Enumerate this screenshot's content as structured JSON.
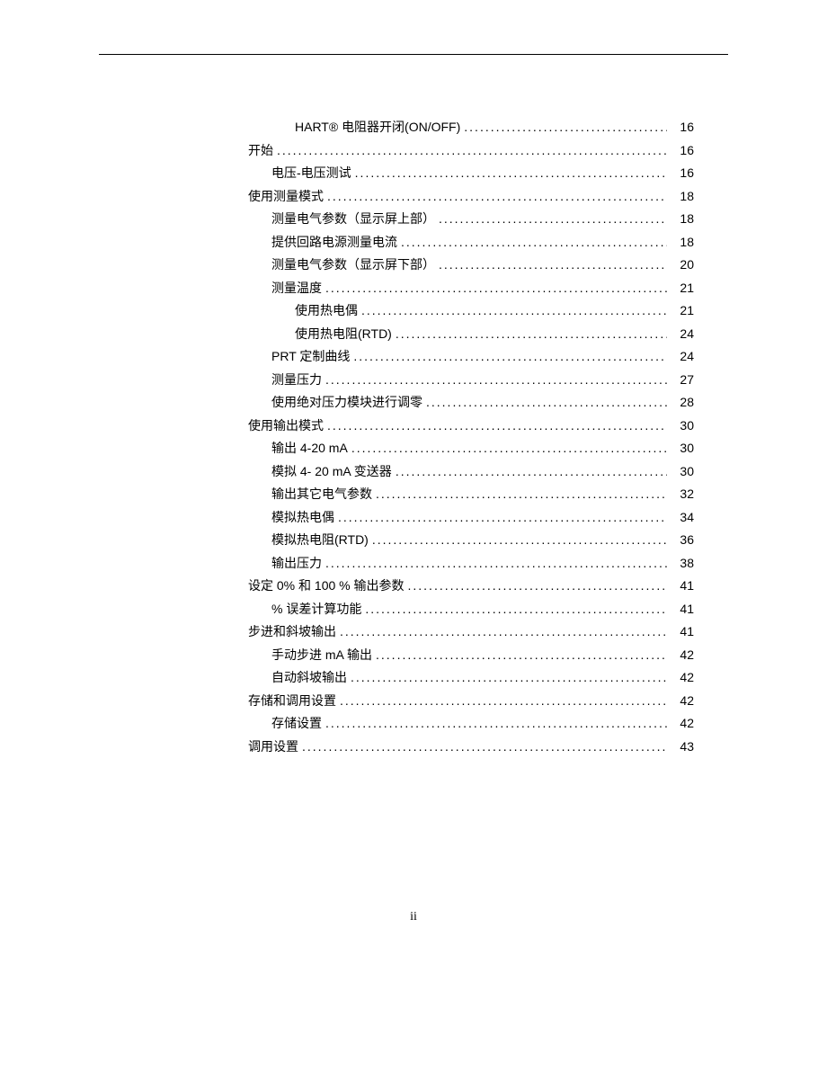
{
  "page_number": "ii",
  "toc": [
    {
      "indent": 2,
      "label": "HART®  电阻器开闭(ON/OFF)",
      "page": "16"
    },
    {
      "indent": 0,
      "label": "开始",
      "page": "16"
    },
    {
      "indent": 1,
      "label": "电压-电压测试",
      "page": "16"
    },
    {
      "indent": 0,
      "label": "使用测量模式",
      "page": "18"
    },
    {
      "indent": 1,
      "label": "测量电气参数（显示屏上部）",
      "page": "18"
    },
    {
      "indent": 1,
      "label": "提供回路电源测量电流",
      "page": "18"
    },
    {
      "indent": 1,
      "label": "测量电气参数（显示屏下部）",
      "page": "20"
    },
    {
      "indent": 1,
      "label": "测量温度",
      "page": "21"
    },
    {
      "indent": 2,
      "label": "使用热电偶",
      "page": "21"
    },
    {
      "indent": 2,
      "label": "使用热电阻(RTD)",
      "page": "24"
    },
    {
      "indent": 1,
      "label": "PRT  定制曲线",
      "page": "24"
    },
    {
      "indent": 1,
      "label": "测量压力",
      "page": "27"
    },
    {
      "indent": 1,
      "label": "使用绝对压力模块进行调零",
      "page": "28"
    },
    {
      "indent": 0,
      "label": "使用输出模式",
      "page": "30"
    },
    {
      "indent": 1,
      "label": "输出  4-20 mA",
      "page": "30"
    },
    {
      "indent": 1,
      "label": "模拟  4- 20 mA 变送器",
      "page": "30"
    },
    {
      "indent": 1,
      "label": "输出其它电气参数",
      "page": "32"
    },
    {
      "indent": 1,
      "label": "模拟热电偶",
      "page": "34"
    },
    {
      "indent": 1,
      "label": "模拟热电阻(RTD)",
      "page": "36"
    },
    {
      "indent": 1,
      "label": "输出压力",
      "page": "38"
    },
    {
      "indent": 0,
      "label": "设定  0%  和  100 %  输出参数",
      "page": "41"
    },
    {
      "indent": 1,
      "label": "%  误差计算功能",
      "page": "41"
    },
    {
      "indent": 0,
      "label": "步进和斜坡输出",
      "page": "41"
    },
    {
      "indent": 1,
      "label": "手动步进  mA  输出",
      "page": "42"
    },
    {
      "indent": 1,
      "label": "自动斜坡输出",
      "page": "42"
    },
    {
      "indent": 0,
      "label": "存储和调用设置",
      "page": "42"
    },
    {
      "indent": 1,
      "label": "存储设置",
      "page": "42"
    },
    {
      "indent": 0,
      "label": "调用设置",
      "page": "43"
    }
  ]
}
